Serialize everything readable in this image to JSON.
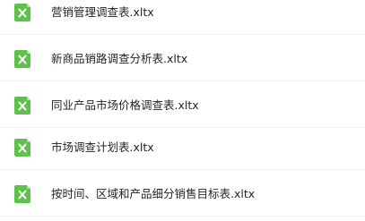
{
  "files": [
    {
      "name": "营销管理调查表.xltx",
      "icon": "excel-template-icon"
    },
    {
      "name": "新商品销路调查分析表.xltx",
      "icon": "excel-template-icon"
    },
    {
      "name": "同业产品市场价格调查表.xltx",
      "icon": "excel-template-icon"
    },
    {
      "name": "市场调查计划表.xltx",
      "icon": "excel-template-icon"
    },
    {
      "name": "按时间、区域和产品细分销售目标表.xltx",
      "icon": "excel-template-icon"
    }
  ],
  "colors": {
    "icon_green": "#5dc14b",
    "icon_fold": "#a8e09c",
    "text": "#1f2329",
    "divider": "#eef0f2"
  }
}
